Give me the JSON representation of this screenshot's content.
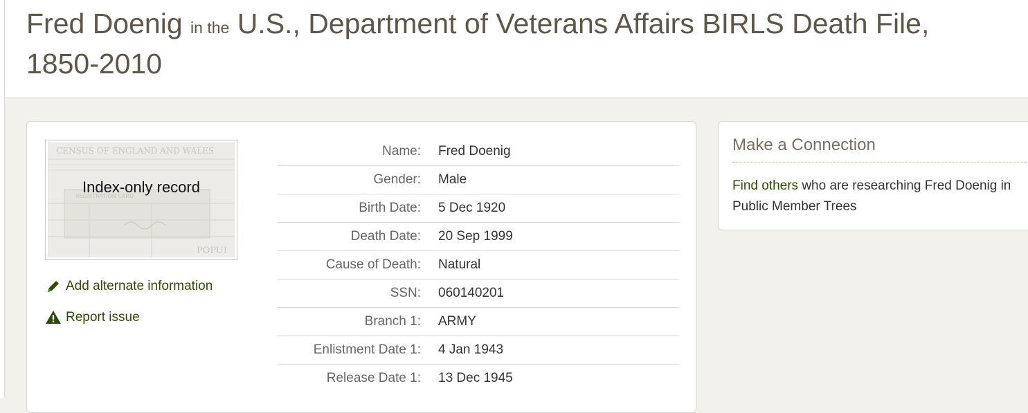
{
  "header": {
    "person": "Fred Doenig",
    "connector": "in the",
    "collection": "U.S., Department of Veterans Affairs BIRLS Death File, 1850-2010"
  },
  "record": {
    "image_label": "Index-only record",
    "image_caption_lines": [
      "CENSUS OF ENGLAND AND WALES",
      "REGISTRATION CARD",
      "POPUI"
    ],
    "actions": [
      {
        "label": "Add alternate information",
        "icon": "pencil-icon"
      },
      {
        "label": "Report issue",
        "icon": "warning-icon"
      }
    ],
    "fields": [
      {
        "label": "Name:",
        "value": "Fred Doenig"
      },
      {
        "label": "Gender:",
        "value": "Male"
      },
      {
        "label": "Birth Date:",
        "value": "5 Dec 1920"
      },
      {
        "label": "Death Date:",
        "value": "20 Sep 1999"
      },
      {
        "label": "Cause of Death:",
        "value": "Natural"
      },
      {
        "label": "SSN:",
        "value": "060140201"
      },
      {
        "label": "Branch 1:",
        "value": "ARMY"
      },
      {
        "label": "Enlistment Date 1:",
        "value": "4 Jan 1943"
      },
      {
        "label": "Release Date 1:",
        "value": "13 Dec 1945"
      }
    ]
  },
  "connection": {
    "title": "Make a Connection",
    "link_text": "Find others",
    "text": " who are researching Fred Doenig in Public Member Trees"
  },
  "colors": {
    "title": "#5f5647",
    "link": "#2f4a07",
    "background": "#f2f1ec"
  }
}
